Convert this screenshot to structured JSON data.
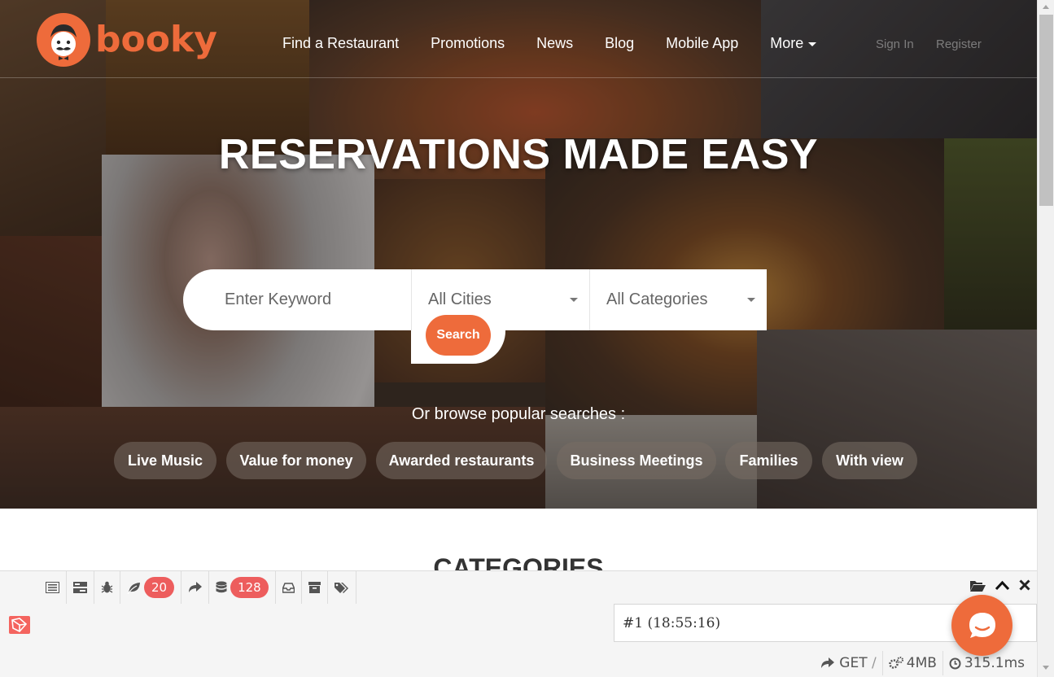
{
  "brand": {
    "name": "booky",
    "color": "#ee6b3b"
  },
  "nav": {
    "links": [
      "Find a Restaurant",
      "Promotions",
      "News",
      "Blog",
      "Mobile App",
      "More"
    ],
    "sign_in": "Sign In",
    "register": "Register"
  },
  "hero": {
    "headline": "RESERVATIONS MADE EASY",
    "search": {
      "keyword_placeholder": "Enter Keyword",
      "city_selected": "All Cities",
      "category_selected": "All Categories",
      "button_label": "Search"
    },
    "browse_label": "Or browse popular searches :",
    "popular_searches": [
      "Live Music",
      "Value for money",
      "Awarded restaurants",
      "Business Meetings",
      "Families",
      "With view"
    ]
  },
  "categories_heading": "CATEGORIES",
  "debugbar": {
    "badges": {
      "messages": "20",
      "queries": "128"
    },
    "request_label": "#1 (18:55:16)",
    "method": "GET",
    "route": "/",
    "memory": "4MB",
    "time": "315.1ms",
    "icons": [
      "messages-icon",
      "timeline-icon",
      "exceptions-icon",
      "views-icon",
      "route-icon",
      "database-icon",
      "mails-icon",
      "session-icon",
      "request-icon"
    ]
  }
}
